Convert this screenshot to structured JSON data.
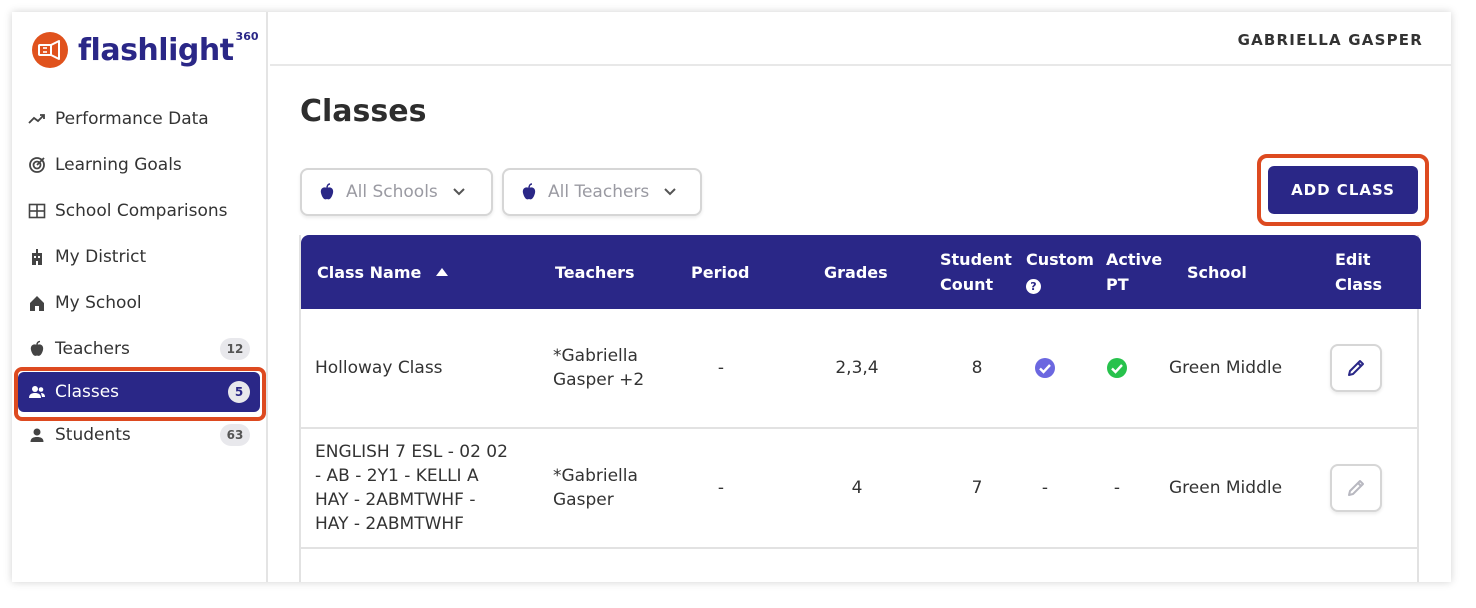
{
  "brand": {
    "name": "flashlight",
    "superscript": "360",
    "accent": "#e0521d",
    "primary": "#2a2787"
  },
  "topbar": {
    "user_name": "GABRIELLA GASPER"
  },
  "sidebar": {
    "items": [
      {
        "label": "Performance Data",
        "icon": "trend-line-icon"
      },
      {
        "label": "Learning Goals",
        "icon": "target-icon"
      },
      {
        "label": "School Comparisons",
        "icon": "grid-table-icon"
      },
      {
        "label": "My District",
        "icon": "district-building-icon"
      },
      {
        "label": "My School",
        "icon": "school-building-icon"
      },
      {
        "label": "Teachers",
        "icon": "apple-icon",
        "badge": "12"
      },
      {
        "label": "Classes",
        "icon": "users-icon",
        "badge": "5",
        "active": true
      },
      {
        "label": "Students",
        "icon": "user-icon",
        "badge": "63"
      }
    ]
  },
  "main": {
    "title": "Classes",
    "filters": {
      "school": "All Schools",
      "teacher": "All Teachers"
    },
    "add_button": "ADD CLASS"
  },
  "table": {
    "headers": {
      "class_name": "Class Name",
      "teachers": "Teachers",
      "period": "Period",
      "grades": "Grades",
      "student_count_1": "Student",
      "student_count_2": "Count",
      "custom": "Custom",
      "active_pt_1": "Active",
      "active_pt_2": "PT",
      "school": "School",
      "edit_class_1": "Edit",
      "edit_class_2": "Class"
    },
    "rows": [
      {
        "class_name": "Holloway Class",
        "teachers_1": "*Gabriella",
        "teachers_2": "Gasper +2",
        "period": "-",
        "grades": "2,3,4",
        "student_count": "8",
        "custom": "check",
        "active_pt": "check",
        "school": "Green Middle"
      },
      {
        "class_name_1": "ENGLISH 7 ESL - 02 02",
        "class_name_2": "- AB - 2Y1 - KELLI A",
        "class_name_3": "HAY - 2ABMTWHF -",
        "class_name_4": "HAY - 2ABMTWHF",
        "teachers_1": "*Gabriella",
        "teachers_2": "Gasper",
        "period": "-",
        "grades": "4",
        "student_count": "7",
        "custom": "-",
        "active_pt": "-",
        "school": "Green Middle"
      }
    ]
  }
}
